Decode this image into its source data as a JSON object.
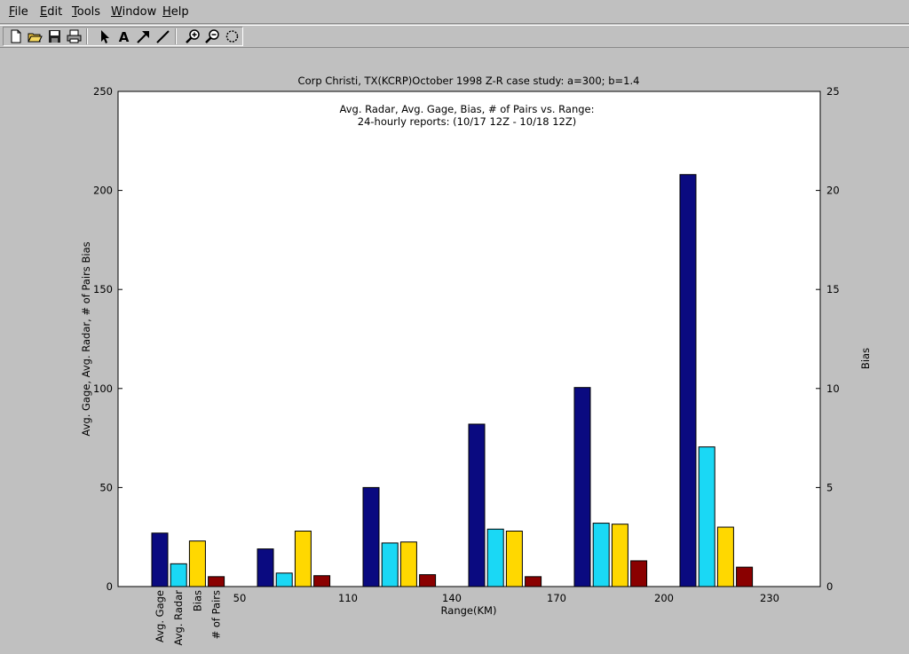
{
  "menu": [
    "File",
    "Edit",
    "Tools",
    "Window",
    "Help"
  ],
  "toolbar": {
    "tools": [
      {
        "name": "new-figure-icon",
        "glyph": "new"
      },
      {
        "name": "open-file-icon",
        "glyph": "open"
      },
      {
        "name": "save-icon",
        "glyph": "save"
      },
      {
        "name": "print-icon",
        "glyph": "print"
      },
      {
        "name": "select-arrow-icon",
        "glyph": "arrow"
      },
      {
        "name": "insert-text-icon",
        "glyph": "text"
      },
      {
        "name": "insert-arrow-icon",
        "glyph": "diag-arrow"
      },
      {
        "name": "insert-line-icon",
        "glyph": "line"
      },
      {
        "name": "zoom-in-icon",
        "glyph": "zoom-in"
      },
      {
        "name": "zoom-out-icon",
        "glyph": "zoom-out"
      },
      {
        "name": "rotate-icon",
        "glyph": "rotate"
      }
    ]
  },
  "chart_data": {
    "type": "bar",
    "title": "Corp Christi, TX(KCRP)October 1998 Z-R case study: a=300; b=1.4",
    "subtitle_lines": [
      "Avg. Radar, Avg. Gage, Bias, # of Pairs vs. Range:",
      "24-hourly reports: (10/17 12Z - 10/18 12Z)"
    ],
    "xlabel": "Range(KM)",
    "ylabel": "Avg. Gage, Avg. Radar, # of Pairs Bias",
    "y2label": "Bias",
    "ylim": [
      0,
      250
    ],
    "y2lim": [
      0,
      25
    ],
    "yticks": [
      0,
      50,
      100,
      150,
      200,
      250
    ],
    "y2ticks": [
      0,
      5,
      10,
      15,
      20,
      25
    ],
    "xtick_labels": [
      "50",
      "110",
      "140",
      "170",
      "200",
      "230"
    ],
    "group_labels": [
      "Avg. Gage",
      "Avg. Radar",
      "Bias",
      "# of Pairs"
    ],
    "grid": false,
    "colors": [
      "#0a0a80",
      "#1ad8f5",
      "#ffd800",
      "#8a0000"
    ],
    "series": [
      {
        "name": "Avg. Gage",
        "values": [
          27,
          19,
          50,
          82,
          100.5,
          208
        ]
      },
      {
        "name": "Avg. Radar",
        "values": [
          11.5,
          6.8,
          22,
          29,
          32,
          70.5
        ]
      },
      {
        "name": "Bias",
        "values": [
          23,
          28,
          22.5,
          28,
          31.5,
          30
        ]
      },
      {
        "name": "# of Pairs",
        "values": [
          5,
          5.5,
          6,
          5,
          13,
          9.8
        ]
      }
    ]
  }
}
